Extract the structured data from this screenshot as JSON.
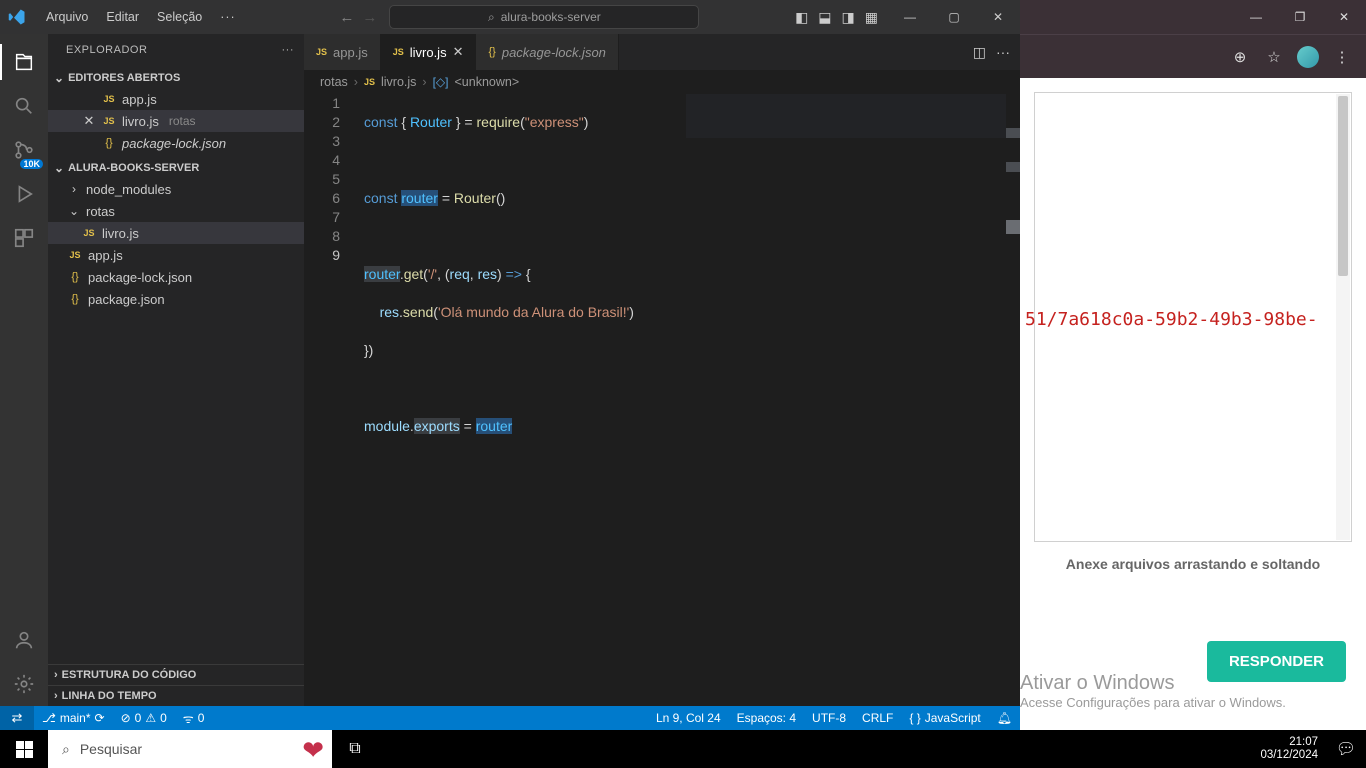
{
  "titlebar": {
    "menus": [
      "Arquivo",
      "Editar",
      "Seleção"
    ],
    "search": "alura-books-server"
  },
  "explorer": {
    "title": "EXPLORADOR",
    "openEditors": "EDITORES ABERTOS",
    "project": "ALURA-BOOKS-SERVER",
    "outline": "ESTRUTURA DO CÓDIGO",
    "timeline": "LINHA DO TEMPO",
    "items": {
      "appjs": "app.js",
      "livrojs": "livro.js",
      "livropath": "rotas",
      "pkglock": "package-lock.json",
      "node_modules": "node_modules",
      "rotas": "rotas",
      "pkgjson": "package.json"
    }
  },
  "tabs": {
    "appjs": "app.js",
    "livrojs": "livro.js",
    "pkglock": "package-lock.json"
  },
  "breadcrumb": {
    "rotas": "rotas",
    "livro": "livro.js",
    "unknown": "<unknown>"
  },
  "code": {
    "l1_const": "const",
    "l1_router": "Router",
    "l1_require": "require",
    "l1_express": "\"express\"",
    "l3_const": "const",
    "l3_router_var": "router",
    "l3_RouterFn": "Router",
    "l5_router": "router",
    "l5_get": "get",
    "l5_path": "'/'",
    "l5_req": "req",
    "l5_res": "res",
    "l6_res": "res",
    "l6_send": "send",
    "l6_msg": "'Olá mundo da Alura do Brasil!'",
    "l9_module": "module",
    "l9_exports": "exports",
    "l9_router": "router"
  },
  "lineNumbers": [
    "1",
    "2",
    "3",
    "4",
    "5",
    "6",
    "7",
    "8",
    "9"
  ],
  "statusbar": {
    "branch": "main*",
    "errors": "0",
    "warnings": "0",
    "ports": "0",
    "lncol": "Ln 9, Col 24",
    "spaces": "Espaços: 4",
    "enc": "UTF-8",
    "eol": "CRLF",
    "lang": "JavaScript"
  },
  "activity": {
    "badge": "10K"
  },
  "browser": {
    "text": "51/7a618c0a-59b2-49b3-98be-",
    "hint": "Anexe arquivos arrastando e soltando",
    "button": "RESPONDER"
  },
  "activate": {
    "t1": "Ativar o Windows",
    "t2": "Acesse Configurações para ativar o Windows."
  },
  "taskbar": {
    "search": "Pesquisar",
    "time": "21:07",
    "date": "03/12/2024"
  }
}
